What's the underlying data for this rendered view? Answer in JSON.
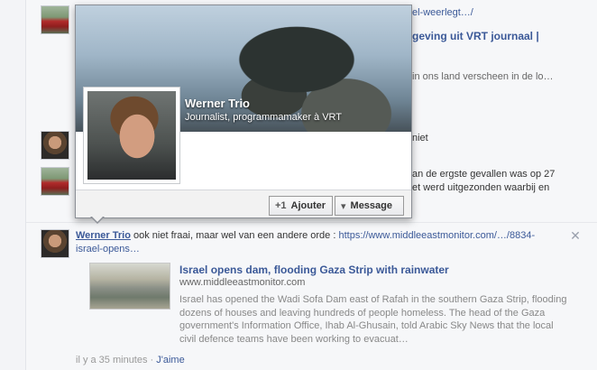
{
  "feed": {
    "fragments": {
      "f1": "el-weerlegt…/",
      "f2": "geving uit VRT journaal |",
      "f3": "in ons land verscheen in de lo…",
      "f4": "niet",
      "f5": "an de ergste gevallen was op 27",
      "f6": "et werd uitgezonden waarbij en"
    }
  },
  "hovercard": {
    "name": "Werner Trio",
    "subtitle": "Journalist, programmamaker à VRT",
    "add_button": "Ajouter",
    "add_icon": "+1",
    "message_button": "Message",
    "message_icon": "▾"
  },
  "post": {
    "author": "Werner Trio",
    "text": " ook niet fraai, maar wel van een andere orde : ",
    "url_part1": "https://www.middleeastmonitor.com/…/8834-",
    "url_part2": "israel-opens…",
    "close_icon": "✕",
    "share": {
      "title": "Israel opens dam, flooding Gaza Strip with rainwater",
      "domain": "www.middleeastmonitor.com",
      "description": "Israel has opened the Wadi Sofa Dam east of Rafah in the southern Gaza Strip, flooding dozens of houses and leaving hundreds of people homeless. The head of the Gaza government's Information Office, Ihab Al-Ghusain, told Arabic Sky News that the local civil defence teams have been working to evacuat…"
    },
    "time": "il y a 35 minutes",
    "separator": " · ",
    "like": "J'aime"
  }
}
